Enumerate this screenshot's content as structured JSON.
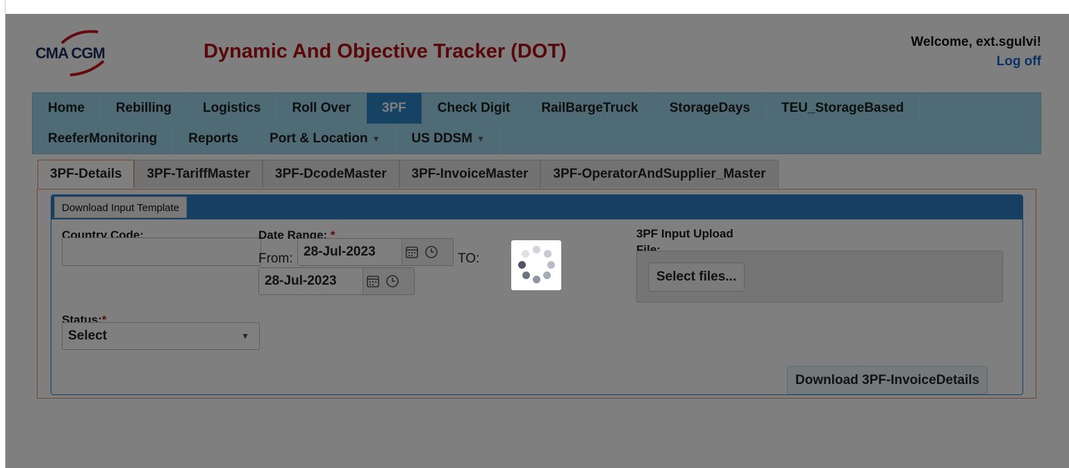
{
  "header": {
    "logo_text": "CMA CGM",
    "app_title": "Dynamic And Objective Tracker (DOT)",
    "welcome": "Welcome, ext.sgulvi!",
    "logoff": "Log off"
  },
  "nav": {
    "row1": [
      {
        "label": "Home"
      },
      {
        "label": "Rebilling"
      },
      {
        "label": "Logistics"
      },
      {
        "label": "Roll Over"
      },
      {
        "label": "3PF",
        "active": true
      },
      {
        "label": "Check Digit"
      },
      {
        "label": "RailBargeTruck"
      },
      {
        "label": "StorageDays"
      },
      {
        "label": "TEU_StorageBased"
      }
    ],
    "row2": [
      {
        "label": "ReeferMonitoring"
      },
      {
        "label": "Reports"
      },
      {
        "label": "Port & Location",
        "dropdown": true
      },
      {
        "label": "US DDSM",
        "dropdown": true
      }
    ]
  },
  "subtabs": [
    "3PF-Details",
    "3PF-TariffMaster",
    "3PF-DcodeMaster",
    "3PF-InvoiceMaster",
    "3PF-OperatorAndSupplier_Master"
  ],
  "form": {
    "template_button": "Download Input Template",
    "country_code_label": "Country Code:",
    "country_code_value": "",
    "date_range_label": "Date Range:",
    "required_mark": "*",
    "from_label": "From:",
    "from_date": "28-Jul-2023",
    "to_label": "TO:",
    "to_date": "28-Jul-2023",
    "upload_label_line1": "3PF Input Upload",
    "upload_label_line2": "File:",
    "select_files": "Select files...",
    "status_label": "Status:",
    "status_value": "Select",
    "download_button": "Download 3PF-InvoiceDetails"
  },
  "colors": {
    "brand_red": "#b40f14",
    "nav_bg": "#9fd7ea",
    "nav_active": "#2c86c9",
    "panel_header": "#2f7fc5",
    "link": "#1a67c8",
    "overlay": "rgba(0,0,0,0.5)"
  },
  "icons": [
    "calendar-icon",
    "clock-icon",
    "dropdown-caret-icon",
    "loading-spinner-icon"
  ]
}
